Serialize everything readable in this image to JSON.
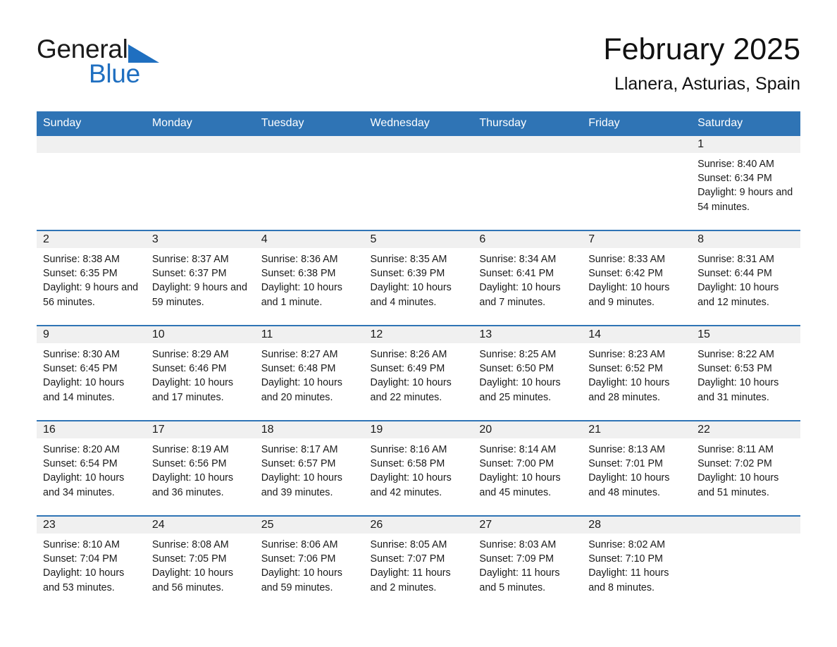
{
  "brand": {
    "name_top": "General",
    "name_bottom": "Blue",
    "flag_icon": "blue-triangle-flag-icon",
    "accent_color": "#1f6fc0"
  },
  "header": {
    "month_title": "February 2025",
    "location": "Llanera, Asturias, Spain"
  },
  "theme": {
    "header_blue": "#2f74b5",
    "date_strip_gray": "#f0f0f0",
    "text_color": "#1a1a1a"
  },
  "calendar": {
    "weekday_headers": [
      "Sunday",
      "Monday",
      "Tuesday",
      "Wednesday",
      "Thursday",
      "Friday",
      "Saturday"
    ],
    "weeks": [
      [
        {
          "day": "",
          "sunrise": "",
          "sunset": "",
          "daylight": ""
        },
        {
          "day": "",
          "sunrise": "",
          "sunset": "",
          "daylight": ""
        },
        {
          "day": "",
          "sunrise": "",
          "sunset": "",
          "daylight": ""
        },
        {
          "day": "",
          "sunrise": "",
          "sunset": "",
          "daylight": ""
        },
        {
          "day": "",
          "sunrise": "",
          "sunset": "",
          "daylight": ""
        },
        {
          "day": "",
          "sunrise": "",
          "sunset": "",
          "daylight": ""
        },
        {
          "day": "1",
          "sunrise": "Sunrise: 8:40 AM",
          "sunset": "Sunset: 6:34 PM",
          "daylight": "Daylight: 9 hours and 54 minutes."
        }
      ],
      [
        {
          "day": "2",
          "sunrise": "Sunrise: 8:38 AM",
          "sunset": "Sunset: 6:35 PM",
          "daylight": "Daylight: 9 hours and 56 minutes."
        },
        {
          "day": "3",
          "sunrise": "Sunrise: 8:37 AM",
          "sunset": "Sunset: 6:37 PM",
          "daylight": "Daylight: 9 hours and 59 minutes."
        },
        {
          "day": "4",
          "sunrise": "Sunrise: 8:36 AM",
          "sunset": "Sunset: 6:38 PM",
          "daylight": "Daylight: 10 hours and 1 minute."
        },
        {
          "day": "5",
          "sunrise": "Sunrise: 8:35 AM",
          "sunset": "Sunset: 6:39 PM",
          "daylight": "Daylight: 10 hours and 4 minutes."
        },
        {
          "day": "6",
          "sunrise": "Sunrise: 8:34 AM",
          "sunset": "Sunset: 6:41 PM",
          "daylight": "Daylight: 10 hours and 7 minutes."
        },
        {
          "day": "7",
          "sunrise": "Sunrise: 8:33 AM",
          "sunset": "Sunset: 6:42 PM",
          "daylight": "Daylight: 10 hours and 9 minutes."
        },
        {
          "day": "8",
          "sunrise": "Sunrise: 8:31 AM",
          "sunset": "Sunset: 6:44 PM",
          "daylight": "Daylight: 10 hours and 12 minutes."
        }
      ],
      [
        {
          "day": "9",
          "sunrise": "Sunrise: 8:30 AM",
          "sunset": "Sunset: 6:45 PM",
          "daylight": "Daylight: 10 hours and 14 minutes."
        },
        {
          "day": "10",
          "sunrise": "Sunrise: 8:29 AM",
          "sunset": "Sunset: 6:46 PM",
          "daylight": "Daylight: 10 hours and 17 minutes."
        },
        {
          "day": "11",
          "sunrise": "Sunrise: 8:27 AM",
          "sunset": "Sunset: 6:48 PM",
          "daylight": "Daylight: 10 hours and 20 minutes."
        },
        {
          "day": "12",
          "sunrise": "Sunrise: 8:26 AM",
          "sunset": "Sunset: 6:49 PM",
          "daylight": "Daylight: 10 hours and 22 minutes."
        },
        {
          "day": "13",
          "sunrise": "Sunrise: 8:25 AM",
          "sunset": "Sunset: 6:50 PM",
          "daylight": "Daylight: 10 hours and 25 minutes."
        },
        {
          "day": "14",
          "sunrise": "Sunrise: 8:23 AM",
          "sunset": "Sunset: 6:52 PM",
          "daylight": "Daylight: 10 hours and 28 minutes."
        },
        {
          "day": "15",
          "sunrise": "Sunrise: 8:22 AM",
          "sunset": "Sunset: 6:53 PM",
          "daylight": "Daylight: 10 hours and 31 minutes."
        }
      ],
      [
        {
          "day": "16",
          "sunrise": "Sunrise: 8:20 AM",
          "sunset": "Sunset: 6:54 PM",
          "daylight": "Daylight: 10 hours and 34 minutes."
        },
        {
          "day": "17",
          "sunrise": "Sunrise: 8:19 AM",
          "sunset": "Sunset: 6:56 PM",
          "daylight": "Daylight: 10 hours and 36 minutes."
        },
        {
          "day": "18",
          "sunrise": "Sunrise: 8:17 AM",
          "sunset": "Sunset: 6:57 PM",
          "daylight": "Daylight: 10 hours and 39 minutes."
        },
        {
          "day": "19",
          "sunrise": "Sunrise: 8:16 AM",
          "sunset": "Sunset: 6:58 PM",
          "daylight": "Daylight: 10 hours and 42 minutes."
        },
        {
          "day": "20",
          "sunrise": "Sunrise: 8:14 AM",
          "sunset": "Sunset: 7:00 PM",
          "daylight": "Daylight: 10 hours and 45 minutes."
        },
        {
          "day": "21",
          "sunrise": "Sunrise: 8:13 AM",
          "sunset": "Sunset: 7:01 PM",
          "daylight": "Daylight: 10 hours and 48 minutes."
        },
        {
          "day": "22",
          "sunrise": "Sunrise: 8:11 AM",
          "sunset": "Sunset: 7:02 PM",
          "daylight": "Daylight: 10 hours and 51 minutes."
        }
      ],
      [
        {
          "day": "23",
          "sunrise": "Sunrise: 8:10 AM",
          "sunset": "Sunset: 7:04 PM",
          "daylight": "Daylight: 10 hours and 53 minutes."
        },
        {
          "day": "24",
          "sunrise": "Sunrise: 8:08 AM",
          "sunset": "Sunset: 7:05 PM",
          "daylight": "Daylight: 10 hours and 56 minutes."
        },
        {
          "day": "25",
          "sunrise": "Sunrise: 8:06 AM",
          "sunset": "Sunset: 7:06 PM",
          "daylight": "Daylight: 10 hours and 59 minutes."
        },
        {
          "day": "26",
          "sunrise": "Sunrise: 8:05 AM",
          "sunset": "Sunset: 7:07 PM",
          "daylight": "Daylight: 11 hours and 2 minutes."
        },
        {
          "day": "27",
          "sunrise": "Sunrise: 8:03 AM",
          "sunset": "Sunset: 7:09 PM",
          "daylight": "Daylight: 11 hours and 5 minutes."
        },
        {
          "day": "28",
          "sunrise": "Sunrise: 8:02 AM",
          "sunset": "Sunset: 7:10 PM",
          "daylight": "Daylight: 11 hours and 8 minutes."
        },
        {
          "day": "",
          "sunrise": "",
          "sunset": "",
          "daylight": ""
        }
      ]
    ]
  }
}
